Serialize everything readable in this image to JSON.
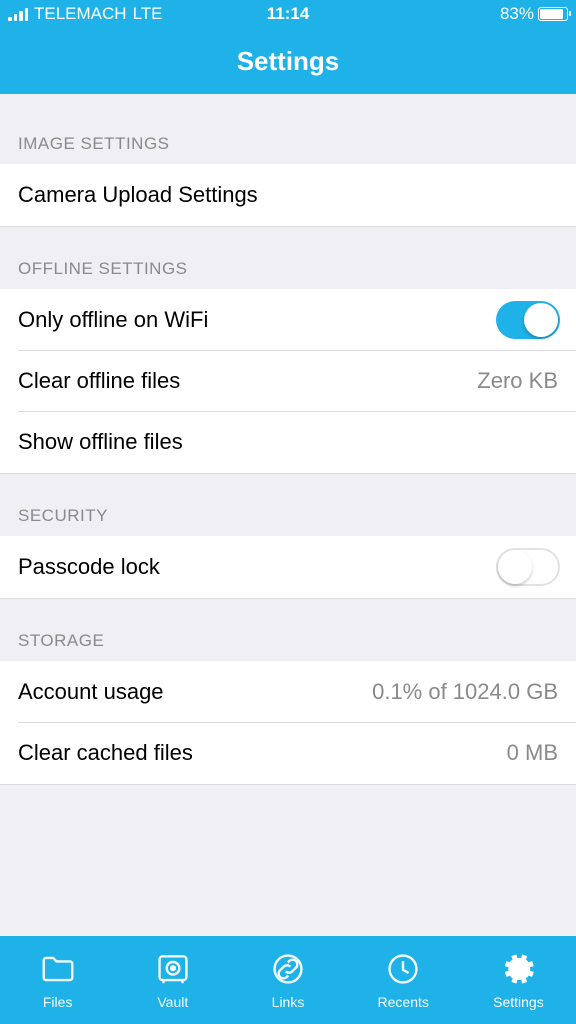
{
  "status": {
    "carrier": "TELEMACH",
    "network": "LTE",
    "time": "11:14",
    "battery_pct": "83%"
  },
  "header": {
    "title": "Settings"
  },
  "sections": {
    "image": {
      "title": "IMAGE SETTINGS",
      "camera_upload": "Camera Upload Settings"
    },
    "offline": {
      "title": "OFFLINE SETTINGS",
      "only_wifi": "Only offline on WiFi",
      "only_wifi_value": true,
      "clear": "Clear offline files",
      "clear_value": "Zero KB",
      "show": "Show offline files"
    },
    "security": {
      "title": "SECURITY",
      "passcode": "Passcode lock",
      "passcode_value": false
    },
    "storage": {
      "title": "STORAGE",
      "account_usage": "Account usage",
      "account_usage_value": "0.1% of 1024.0 GB",
      "clear_cached": "Clear cached files",
      "clear_cached_value": "0 MB"
    }
  },
  "tabs": {
    "files": "Files",
    "vault": "Vault",
    "links": "Links",
    "recents": "Recents",
    "settings": "Settings",
    "active": "settings"
  }
}
